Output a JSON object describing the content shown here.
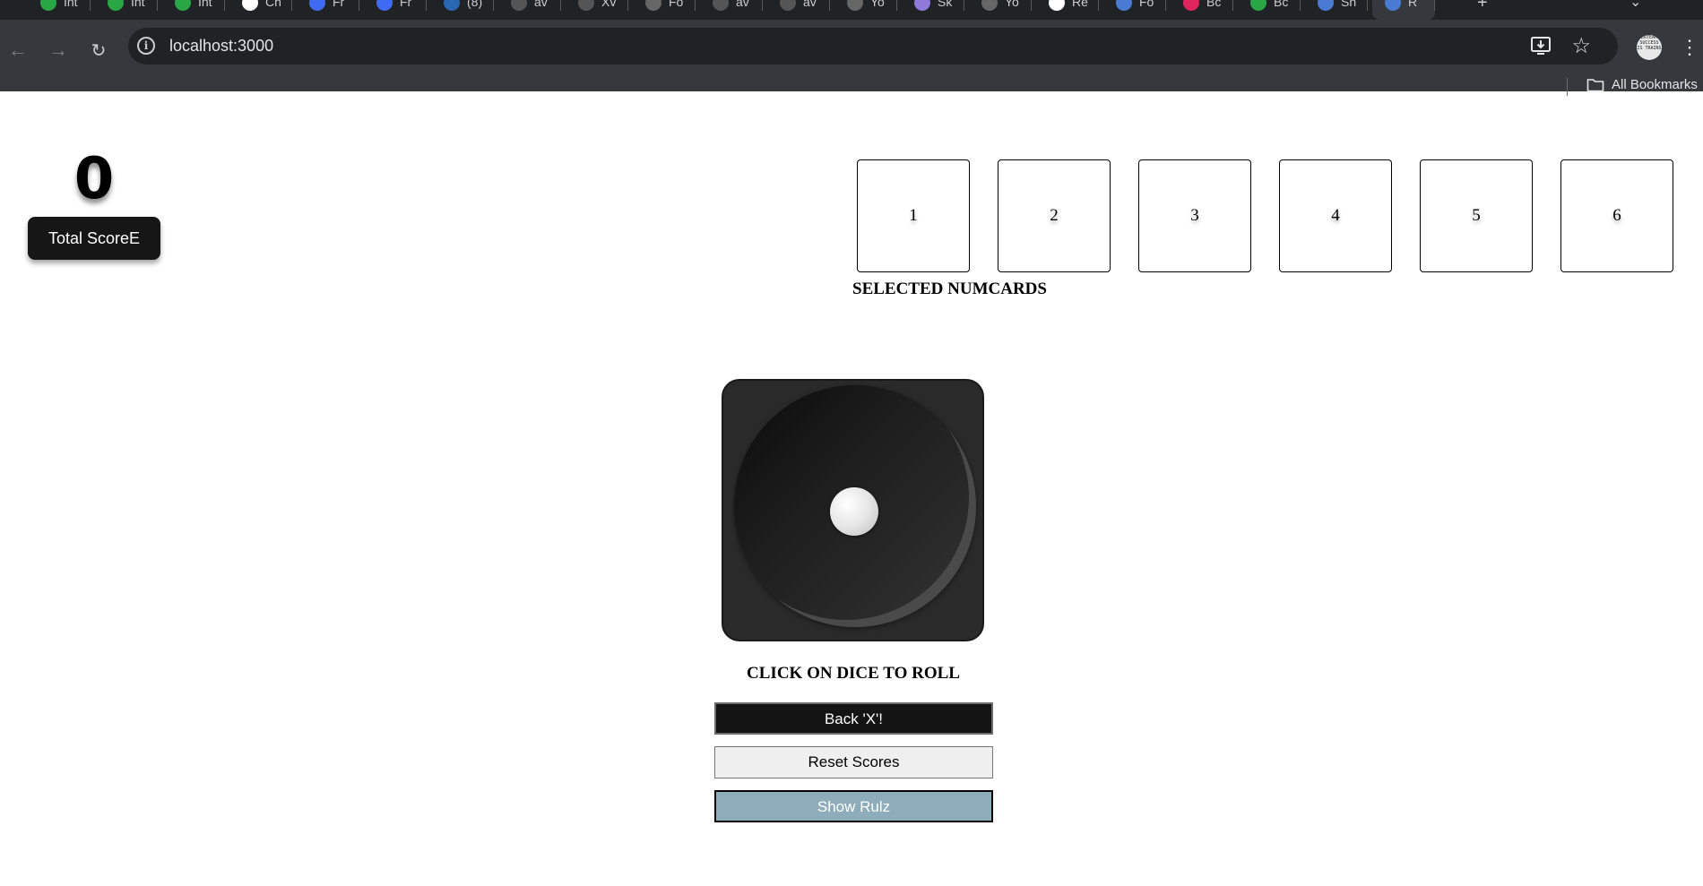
{
  "browser": {
    "tabs": [
      {
        "title": "Int",
        "favicon_color": "#2aa745"
      },
      {
        "title": "Int",
        "favicon_color": "#2aa745"
      },
      {
        "title": "Int",
        "favicon_color": "#2aa745"
      },
      {
        "title": "Ch",
        "favicon_color": "#ffffff"
      },
      {
        "title": "Fr",
        "favicon_color": "#3f6bf2"
      },
      {
        "title": "Fr",
        "favicon_color": "#3f6bf2"
      },
      {
        "title": "(8)",
        "favicon_color": "#2867b2"
      },
      {
        "title": "av",
        "favicon_color": "#555555"
      },
      {
        "title": "Xv",
        "favicon_color": "#555555"
      },
      {
        "title": "Fo",
        "favicon_color": "#666666"
      },
      {
        "title": "av",
        "favicon_color": "#555555"
      },
      {
        "title": "av",
        "favicon_color": "#555555"
      },
      {
        "title": "Yo",
        "favicon_color": "#666666"
      },
      {
        "title": "Sk",
        "favicon_color": "#8f7ad9"
      },
      {
        "title": "Yo",
        "favicon_color": "#666666"
      },
      {
        "title": "Re",
        "favicon_color": "#ffffff"
      },
      {
        "title": "Fo",
        "favicon_color": "#4a7bd4"
      },
      {
        "title": "Bc",
        "favicon_color": "#e0245e"
      },
      {
        "title": "Bc",
        "favicon_color": "#2aa745"
      },
      {
        "title": "Sh",
        "favicon_color": "#4a7bd4"
      },
      {
        "title": "R",
        "favicon_color": "#4a7bd4",
        "active": true
      }
    ],
    "url": "localhost:3000",
    "bookmarks_label": "All Bookmarks",
    "avatar_text": "ERTEAM SUCCESS IS TRAINS"
  },
  "score": {
    "total_value": "0",
    "total_label": "Total ScoreE"
  },
  "numcards": {
    "cards": [
      "1",
      "2",
      "3",
      "4",
      "5",
      "6"
    ],
    "selected_label": "SELECTED NUMCARDS"
  },
  "dice": {
    "current_value": 1,
    "instruction": "CLICK ON DICE TO ROLL"
  },
  "buttons": {
    "back_label": "Back 'X'!",
    "reset_label": "Reset Scores",
    "rules_label": "Show Rulz"
  },
  "colors": {
    "chrome_dark": "#1f2326",
    "chrome_toolbar": "#35393d",
    "score_button": "#161616",
    "rules_button": "#8eadbb"
  }
}
